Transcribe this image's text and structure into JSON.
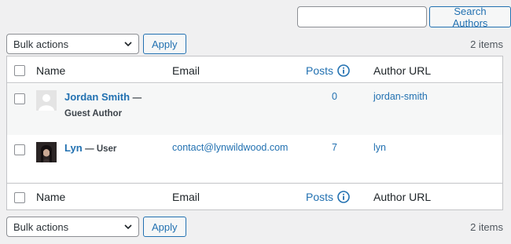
{
  "search": {
    "value": "",
    "button_label": "Search Authors"
  },
  "bulk": {
    "selected": "Bulk actions",
    "apply_label": "Apply",
    "count": "2 items"
  },
  "columns": {
    "name": "Name",
    "email": "Email",
    "posts": "Posts",
    "url": "Author URL"
  },
  "rows": [
    {
      "name": "Jordan Smith",
      "role": "— Guest Author",
      "email": "",
      "posts": "0",
      "url": "jordan-smith",
      "avatar": "default-avatar"
    },
    {
      "name": "Lyn",
      "role": "— User",
      "email": "contact@lynwildwood.com",
      "posts": "7",
      "url": "lyn",
      "avatar": "photo-avatar"
    }
  ],
  "colors": {
    "link": "#2271b1",
    "border": "#c3c4c7",
    "background": "#f0f0f1",
    "row_alt": "#f6f7f7"
  }
}
